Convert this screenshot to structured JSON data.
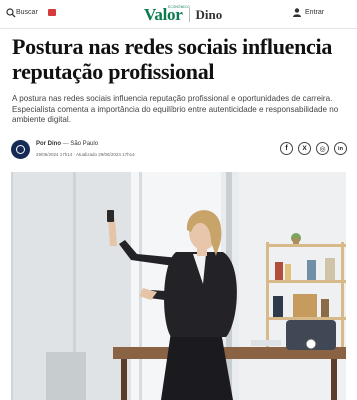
{
  "header": {
    "search_label": "Buscar",
    "logo_valor": "Valor",
    "logo_super": "ECONÔMICO",
    "logo_dino": "Dino",
    "enter_label": "Entrar"
  },
  "article": {
    "headline": "Postura nas redes sociais influencia reputação profissional",
    "lead": "A postura nas redes sociais influencia reputação profissional e oportunidades de carreira. Especialista comenta a importância do equilíbrio entre autenticidade e responsabilidade no ambiente digital.",
    "author": "Por Dino",
    "location": "São Paulo",
    "dates": "29/06/2024 17h14 · Atualizado 29/06/2024 17h14"
  },
  "share": {
    "facebook": "f",
    "x": "X",
    "whatsapp": "◎",
    "linkedin": "in"
  },
  "colors": {
    "brand_green": "#0b7a4d",
    "badge_red": "#d63b3b",
    "avatar_navy": "#152a55"
  }
}
